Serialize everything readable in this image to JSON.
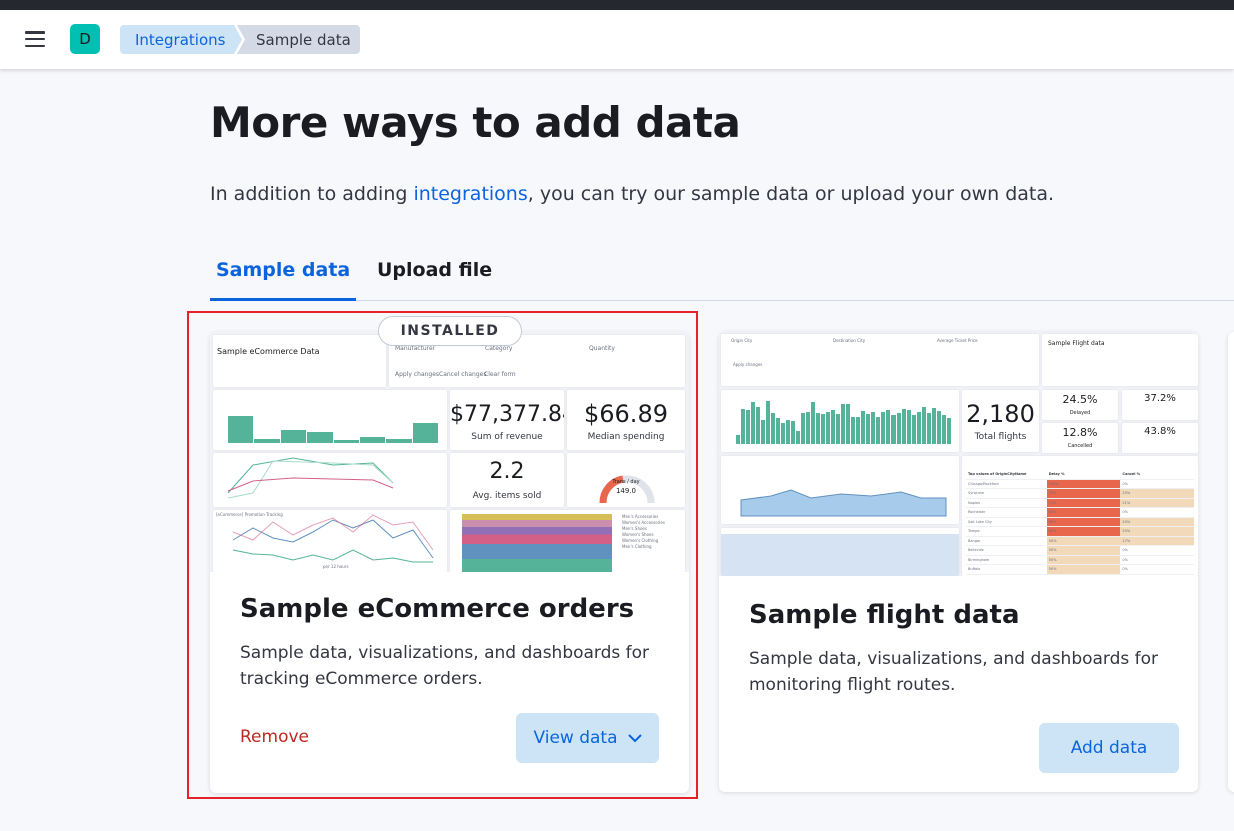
{
  "header": {
    "menu_icon": "hamburger-menu-icon",
    "avatar_letter": "D",
    "avatar_color": "#00bfb3",
    "breadcrumbs": [
      "Integrations",
      "Sample data"
    ]
  },
  "page": {
    "title": "More ways to add data",
    "subtitle_before": "In addition to adding ",
    "subtitle_link": "integrations",
    "subtitle_after": ", you can try our sample data or upload your own data."
  },
  "tabs": [
    {
      "label": "Sample data",
      "active": true
    },
    {
      "label": "Upload file",
      "active": false
    }
  ],
  "cards": [
    {
      "badge": "INSTALLED",
      "title": "Sample eCommerce orders",
      "description": "Sample data, visualizations, and dashboards for tracking eCommerce orders.",
      "remove_label": "Remove",
      "action_label": "View data",
      "thumb": {
        "markdown_title": "Sample eCommerce Data",
        "controls": [
          "Manufacturer",
          "Category",
          "Quantity"
        ],
        "apply": "Apply changes",
        "cancel": "Cancel changes",
        "clear": "Clear form",
        "revenue": "$77,377.84",
        "revenue_label": "Sum of revenue",
        "median": "$66.89",
        "median_label": "Median spending",
        "avg_items": "2.2",
        "avg_items_label": "Avg. items sold",
        "gauge_label": "Trans / day",
        "gauge_value": "149.0",
        "promo_title": "[eCommerce] Promotion Tracking",
        "promo_axis": "per 12 hours",
        "legend": [
          "Men's Accessories",
          "Women's Accessories",
          "Men's Shoes",
          "Women's Shoes",
          "Women's Clothing",
          "Men's Clothing"
        ]
      }
    },
    {
      "title": "Sample flight data",
      "description": "Sample data, visualizations, and dashboards for monitoring flight routes.",
      "action_label": "Add data",
      "thumb": {
        "controls": [
          "Origin City",
          "Destination City",
          "Average Ticket Price"
        ],
        "markdown_title": "Sample Flight data",
        "apply": "Apply changes",
        "total": "2,180",
        "total_label": "Total flights",
        "delayed": "24.5%",
        "delayed_label": "Delayed",
        "delayed_vs": "37.2%",
        "cancelled": "12.8%",
        "cancelled_label": "Cancelled",
        "cancelled_vs": "43.8%",
        "table_header": [
          "Top values of OriginCityName",
          "Delay %",
          "Cancel %"
        ],
        "rows": [
          [
            "Chicago/Rockford",
            "100%",
            "0%"
          ],
          [
            "Syracuse",
            "75%",
            "25%"
          ],
          [
            "Naples",
            "71%",
            "21%"
          ],
          [
            "Rochester",
            "63%",
            "0%"
          ],
          [
            "Salt Lake City",
            "60%",
            "20%"
          ],
          [
            "Tampa",
            "60%",
            "20%"
          ],
          [
            "Bangor",
            "50%",
            "17%"
          ],
          [
            "Belleville",
            "50%",
            "0%"
          ],
          [
            "Birmingham",
            "50%",
            "0%"
          ],
          [
            "Buffalo",
            "50%",
            "0%"
          ]
        ]
      }
    }
  ]
}
